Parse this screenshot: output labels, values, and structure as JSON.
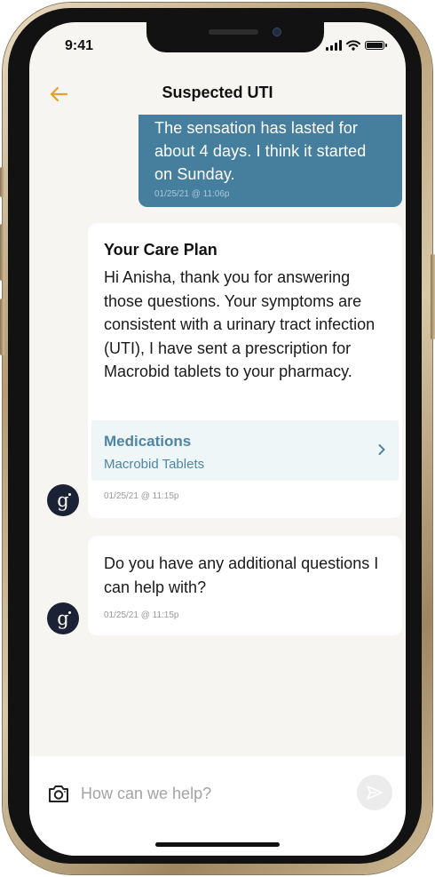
{
  "status_bar": {
    "time": "9:41"
  },
  "nav": {
    "title": "Suspected UTI"
  },
  "messages": {
    "user": {
      "text": "The sensation has lasted for about 4 days. I think it started on Sunday.",
      "timestamp": "01/25/21 @ 11:06p"
    },
    "care_plan": {
      "title": "Your Care Plan",
      "body": "Hi Anisha, thank you for answering those questions. Your symptoms are consistent with a urinary tract infection (UTI), I have sent a prescription for Macrobid tablets to your pharmacy.",
      "medications": {
        "label": "Medications",
        "value": "Macrobid Tablets"
      },
      "timestamp": "01/25/21 @ 11:15p"
    },
    "followup": {
      "body": "Do you have any additional questions I can help with?",
      "timestamp": "01/25/21 @ 11:15p"
    }
  },
  "avatar": {
    "letter": "g"
  },
  "composer": {
    "placeholder": "How can we help?"
  },
  "colors": {
    "accent": "#e5a227",
    "user_bubble": "#467f9e",
    "link_blue": "#4f85a4",
    "medication_bg": "#eef6f7",
    "avatar_bg": "#1c2236",
    "screen_bg": "#f6f5f1"
  }
}
